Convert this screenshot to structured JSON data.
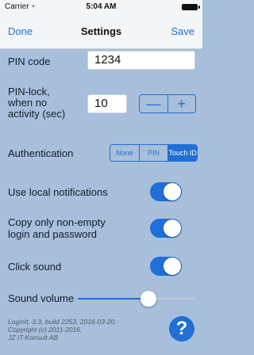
{
  "status_bar": {
    "carrier": "Carrier",
    "time": "5:04 AM"
  },
  "nav": {
    "left": "Done",
    "title": "Settings",
    "right": "Save"
  },
  "pin_code": {
    "label": "PIN code",
    "value": "1234"
  },
  "pin_lock": {
    "label_lines": [
      "PIN-lock,",
      "when no",
      "activity (sec)"
    ],
    "value": "10",
    "minus": "—",
    "plus": "+"
  },
  "authentication": {
    "label": "Authentication",
    "options": [
      "None",
      "PIN",
      "Touch ID"
    ],
    "selected": "Touch ID"
  },
  "toggles": {
    "local_notifications": {
      "label": "Use local notifications",
      "on": true
    },
    "copy_only_nonempty": {
      "label_lines": [
        "Copy only non-empty",
        "login and password"
      ],
      "on": true
    },
    "click_sound": {
      "label": "Click sound",
      "on": true
    }
  },
  "sound_volume": {
    "label": "Sound volume",
    "level": 0.6
  },
  "footer": {
    "lines": [
      "LoginIt, 3.3, build 2253, 2016-03-20,",
      "Copyright (c) 2011-2016,",
      "JZ IT-Konsult AB"
    ],
    "help_glyph": "?"
  },
  "colors": {
    "background": "#a7bfdb",
    "accent": "#1f6fd6",
    "bar": "#f3f5f7"
  },
  "icons": {
    "wifi": "wifi-icon",
    "battery": "battery-icon",
    "help": "help-icon"
  }
}
